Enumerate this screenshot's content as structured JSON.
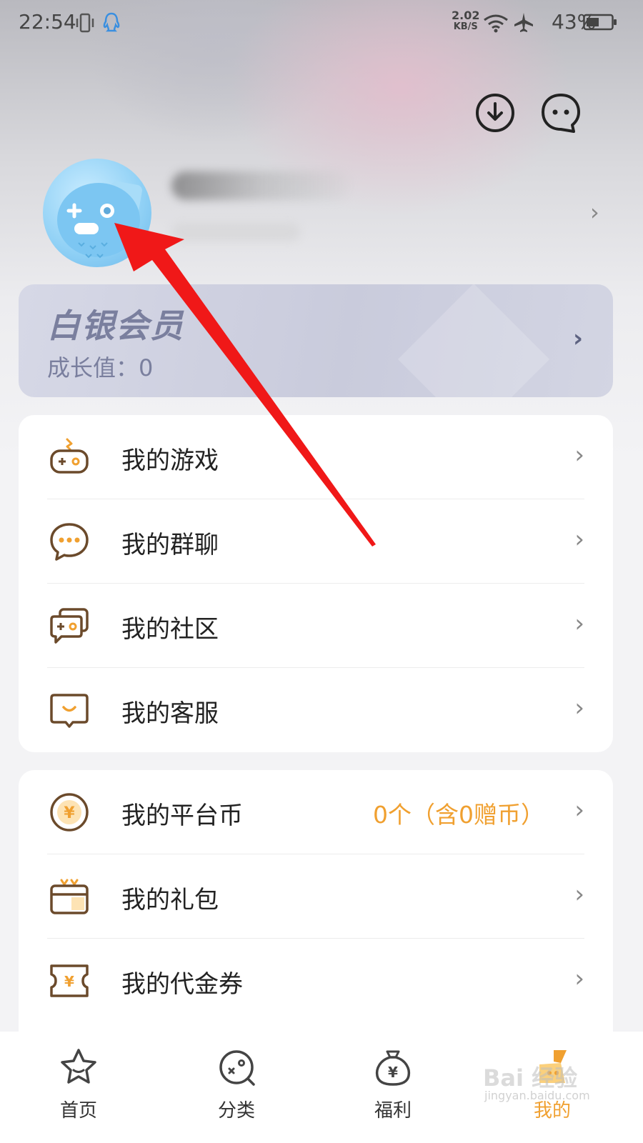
{
  "status_bar": {
    "time": "22:54",
    "net_speed_value": "2.02",
    "net_speed_unit": "KB/S",
    "battery": "43%"
  },
  "member_card": {
    "title": "白银会员",
    "growth_text": "成长值：0"
  },
  "menu_group1": [
    {
      "label": "我的游戏"
    },
    {
      "label": "我的群聊"
    },
    {
      "label": "我的社区"
    },
    {
      "label": "我的客服"
    }
  ],
  "menu_group2": [
    {
      "label": "我的平台币",
      "value": "0个（含0赠币）"
    },
    {
      "label": "我的礼包"
    },
    {
      "label": "我的代金券"
    }
  ],
  "tabs": [
    {
      "label": "首页",
      "icon": "star-icon"
    },
    {
      "label": "分类",
      "icon": "planet-icon"
    },
    {
      "label": "福利",
      "icon": "money-bag-icon"
    },
    {
      "label": "我的",
      "icon": "profile-icon",
      "active": true
    }
  ],
  "watermark": {
    "line1": "Bai 经验",
    "line2": "jingyan.baidu.com"
  },
  "colors": {
    "accent": "#f0a030",
    "icon_brown": "#6b4a2b",
    "arrow": "#f01818"
  }
}
